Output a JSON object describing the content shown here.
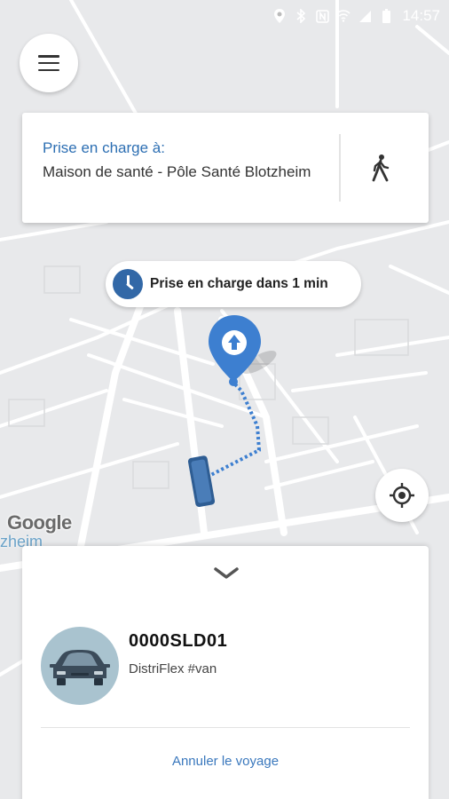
{
  "status_bar": {
    "time": "14:57",
    "icons": [
      "location-icon",
      "bluetooth-icon",
      "nfc-icon",
      "wifi-icon",
      "signal-icon",
      "battery-icon"
    ]
  },
  "menu": {
    "icon": "hamburger-menu-icon"
  },
  "pickup": {
    "title": "Prise en charge à:",
    "place": "Maison de santé - Pôle Santé Blotzheim",
    "walk_icon": "walking-person-icon"
  },
  "eta": {
    "text": "Prise en charge dans 1 min",
    "icon": "clock-icon"
  },
  "map": {
    "attribution": "Google",
    "town_fragment": "zheim",
    "accent": "#3268a7",
    "route_color": "#3d7fd0"
  },
  "locate": {
    "icon": "my-location-icon"
  },
  "sheet": {
    "plate": "0000SLD01",
    "vehicle": "DistriFlex #van",
    "cancel_label": "Annuler le voyage",
    "collapse_icon": "chevron-down-icon"
  }
}
